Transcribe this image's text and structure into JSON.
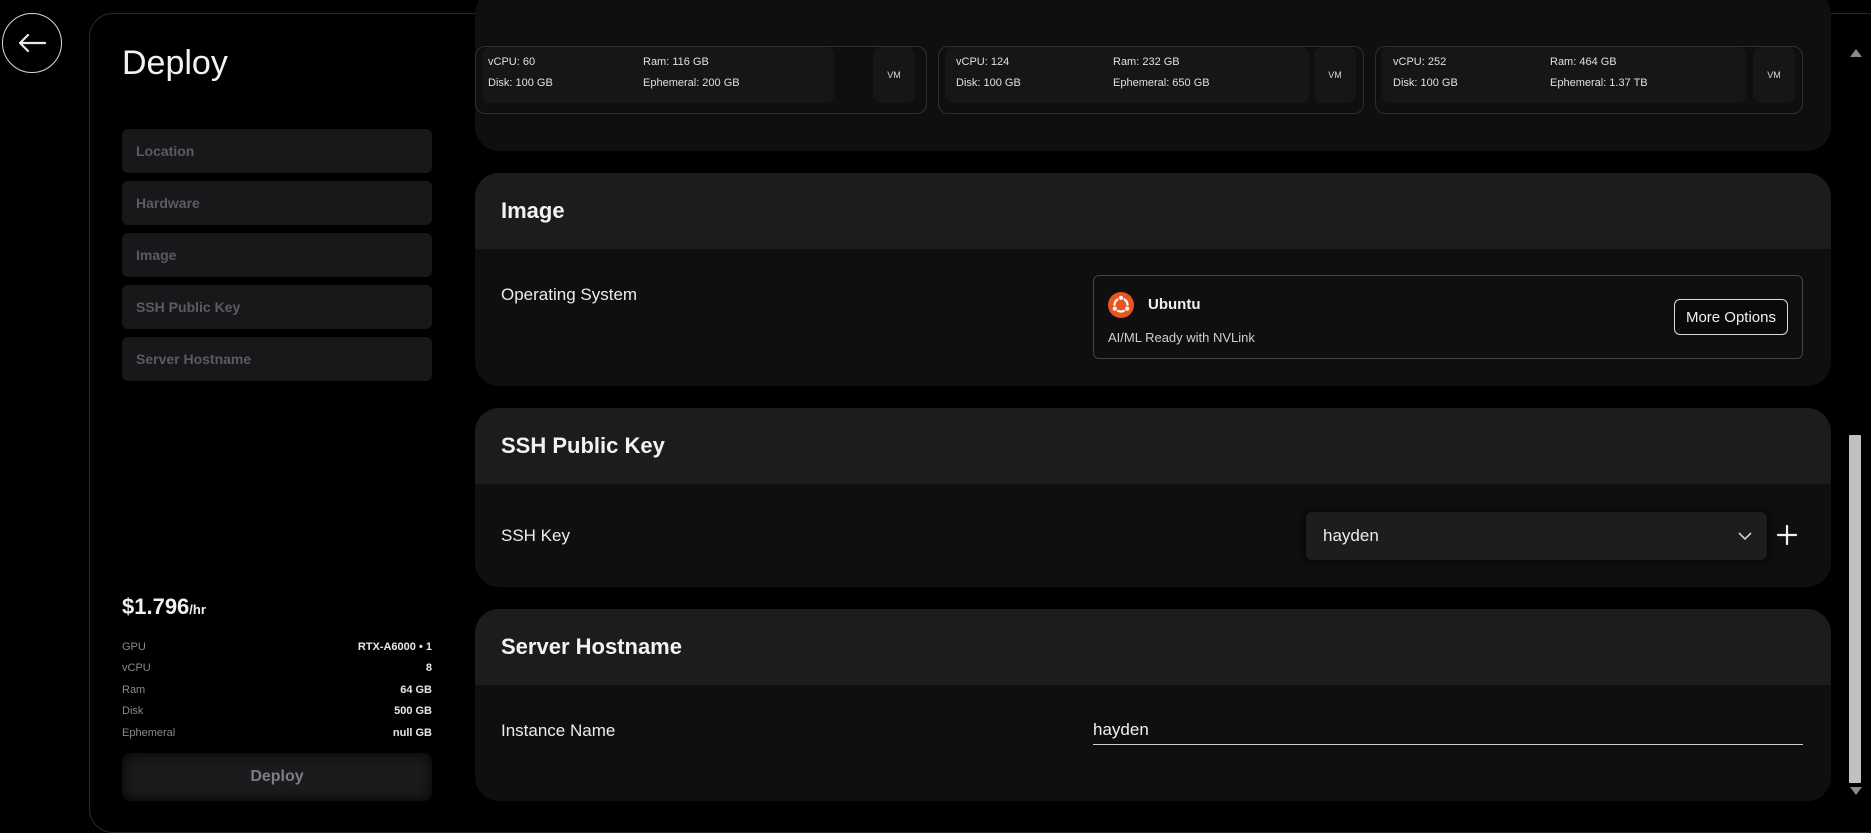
{
  "page": {
    "title": "Deploy"
  },
  "sidebar": {
    "steps": [
      "Location",
      "Hardware",
      "Image",
      "SSH Public Key",
      "Server Hostname"
    ],
    "price": "$1.796",
    "price_unit": "/hr",
    "specs": [
      {
        "label": "GPU",
        "value": "RTX-A6000 • 1"
      },
      {
        "label": "vCPU",
        "value": "8"
      },
      {
        "label": "Ram",
        "value": "64 GB"
      },
      {
        "label": "Disk",
        "value": "500 GB"
      },
      {
        "label": "Ephemeral",
        "value": "null GB"
      }
    ],
    "deploy_label": "Deploy"
  },
  "hardware": {
    "options": [
      {
        "vcpu": "vCPU: 60",
        "disk": "Disk: 100 GB",
        "ram": "Ram: 116 GB",
        "ephemeral": "Ephemeral: 200 GB",
        "badge": "VM"
      },
      {
        "vcpu": "vCPU: 124",
        "disk": "Disk: 100 GB",
        "ram": "Ram: 232 GB",
        "ephemeral": "Ephemeral: 650 GB",
        "badge": "VM"
      },
      {
        "vcpu": "vCPU: 252",
        "disk": "Disk: 100 GB",
        "ram": "Ram: 464 GB",
        "ephemeral": "Ephemeral: 1.37 TB",
        "badge": "VM"
      }
    ]
  },
  "image": {
    "heading": "Image",
    "os_label": "Operating System",
    "os_name": "Ubuntu",
    "os_desc": "AI/ML Ready with NVLink",
    "more_options": "More Options"
  },
  "ssh": {
    "heading": "SSH Public Key",
    "key_label": "SSH Key",
    "selected": "hayden"
  },
  "hostname": {
    "heading": "Server Hostname",
    "label": "Instance Name",
    "value": "hayden"
  },
  "colors": {
    "ubuntu": "#e95420",
    "background": "#000000",
    "card": "#0f0f0f",
    "card_header": "#1c1c1c"
  },
  "icons": {
    "back": "arrow-left-icon",
    "os": "ubuntu-logo-icon",
    "dropdown": "chevron-down-icon",
    "add": "plus-icon"
  }
}
